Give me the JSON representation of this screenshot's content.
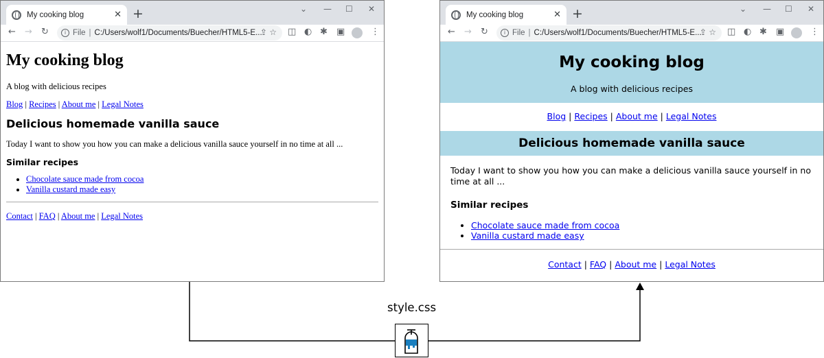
{
  "browser": {
    "tab_title": "My cooking blog",
    "tab_close": "✕",
    "new_tab": "+",
    "window_controls": [
      "⌄",
      "—",
      "☐",
      "✕"
    ],
    "back": "←",
    "forward": "→",
    "reload": "↻",
    "omnibox_info": "i",
    "omnibox_scheme": "File",
    "omnibox_separator": "|",
    "url": "C:/Users/wolf1/Documents/Buecher/HTML5-E...",
    "menu": "⋮"
  },
  "blog": {
    "title": "My cooking blog",
    "tagline": "A blog with delicious recipes",
    "nav": [
      "Blog",
      "Recipes",
      "About me",
      "Legal Notes"
    ],
    "nav_separator": "|",
    "article_title": "Delicious homemade vanilla sauce",
    "article_text": "Today I want to show you how you can make a delicious vanilla sauce yourself in no time at all ...",
    "similar_heading": "Similar recipes",
    "similar_links": [
      "Chocolate sauce made from cocoa",
      "Vanilla custard made easy"
    ],
    "footer_links": [
      "Contact",
      "FAQ",
      "About me",
      "Legal Notes"
    ]
  },
  "diagram": {
    "stylesheet_label": "style.css",
    "stylesheet_icon": "css-file-icon",
    "styled_header_color": "#add8e6",
    "link_color": "#0000ee"
  }
}
